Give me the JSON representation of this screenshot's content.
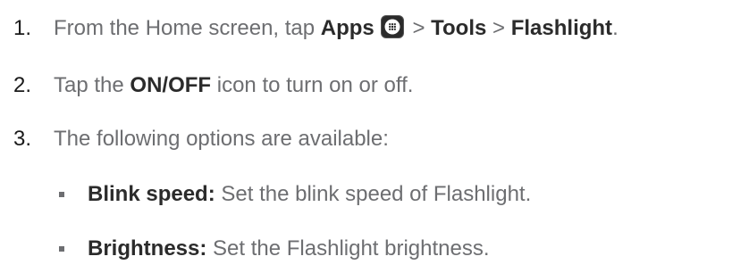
{
  "steps": [
    {
      "number": "1.",
      "pre": "From the Home screen, tap ",
      "apps": "Apps",
      "sep1": " > ",
      "tools": "Tools",
      "sep2": " > ",
      "flashlight": "Flashlight",
      "end": "."
    },
    {
      "number": "2.",
      "pre": "Tap the ",
      "on": "ON",
      "slash": "/",
      "off": "OFF",
      "post": " icon to turn on or off."
    },
    {
      "number": "3.",
      "text": "The following options are available:"
    }
  ],
  "options": [
    {
      "term": "Blink speed:",
      "desc": " Set the blink speed of Flashlight."
    },
    {
      "term": "Brightness:",
      "desc": " Set the Flashlight brightness."
    }
  ],
  "icons": {
    "apps": "apps-grid-icon"
  }
}
